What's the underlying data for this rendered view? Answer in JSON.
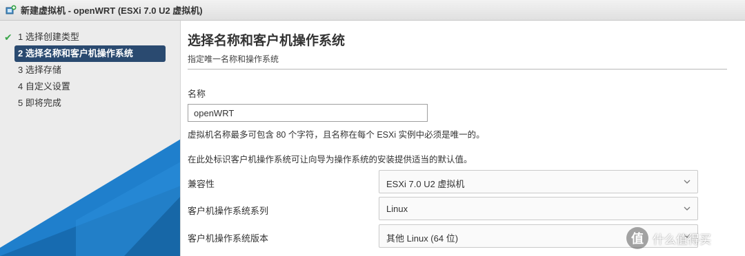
{
  "window": {
    "title": "新建虚拟机 - openWRT (ESXi 7.0 U2 虚拟机)",
    "icon": "vm-add-icon"
  },
  "sidebar": {
    "steps": [
      {
        "label": "1 选择创建类型",
        "completed": true,
        "active": false
      },
      {
        "label": "2 选择名称和客户机操作系统",
        "completed": false,
        "active": true
      },
      {
        "label": "3 选择存储",
        "completed": false,
        "active": false
      },
      {
        "label": "4 自定义设置",
        "completed": false,
        "active": false
      },
      {
        "label": "5 即将完成",
        "completed": false,
        "active": false
      }
    ],
    "check_symbol": "✔"
  },
  "main": {
    "title": "选择名称和客户机操作系统",
    "subtitle": "指定唯一名称和操作系统",
    "name_label": "名称",
    "name_value": "openWRT",
    "name_hint": "虚拟机名称最多可包含 80 个字符，且名称在每个 ESXi 实例中必须是唯一的。",
    "os_info": "在此处标识客户机操作系统可让向导为操作系统的安装提供适当的默认值。",
    "fields": [
      {
        "label": "兼容性",
        "value": "ESXi 7.0 U2 虚拟机"
      },
      {
        "label": "客户机操作系统系列",
        "value": "Linux"
      },
      {
        "label": "客户机操作系统版本",
        "value": "其他 Linux (64 位)"
      }
    ]
  },
  "watermark": {
    "logo_glyph": "值",
    "text": "什么值得买"
  },
  "colors": {
    "active_step_bg": "#2a4a70",
    "check": "#3aa64a",
    "sidebar_bg": "#ececec",
    "sidebar_accent": "#1e7bc8"
  }
}
